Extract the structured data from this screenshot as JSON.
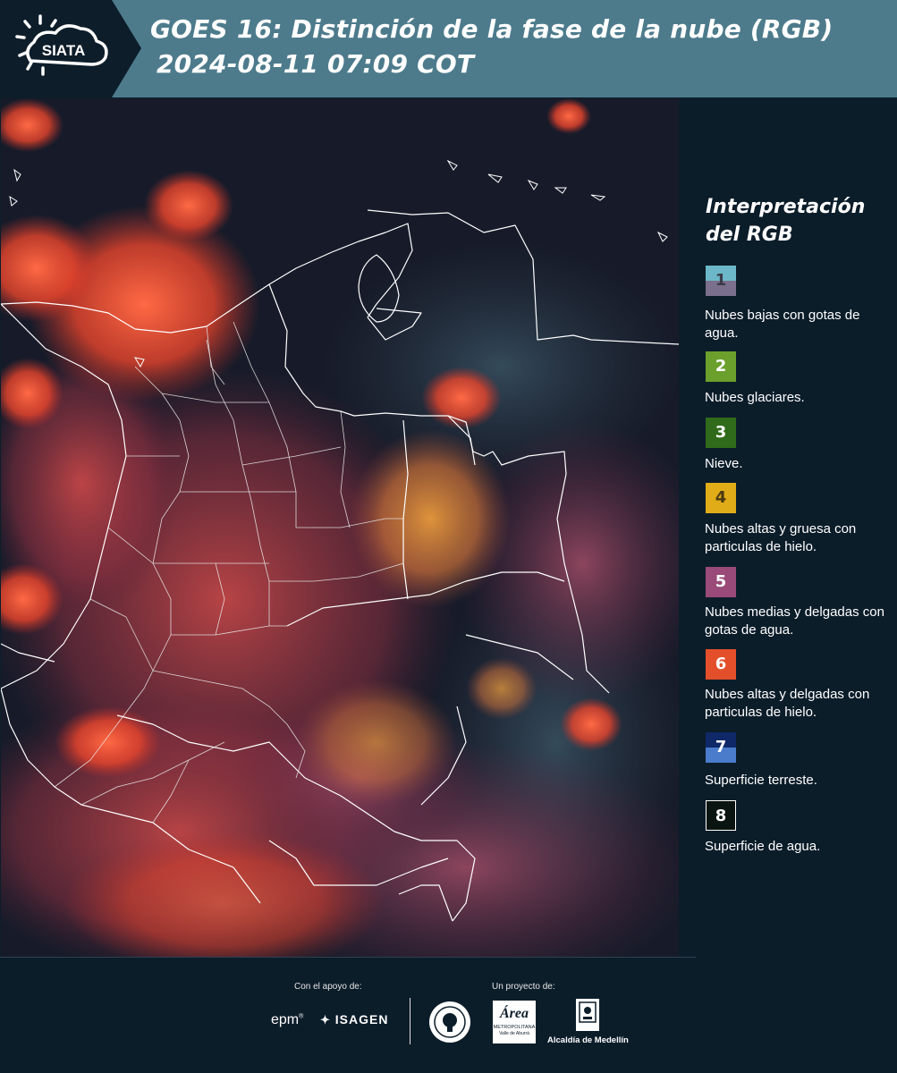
{
  "header": {
    "logo_text": "SIATA",
    "title_line1": "GOES 16: Distinción de la fase de la nube (RGB)",
    "title_line2": "2024-08-11 07:09 COT"
  },
  "map": {
    "description_icon": "satellite-rgb-image"
  },
  "legend": {
    "title": "Interpretación del RGB",
    "items": [
      {
        "number": "1",
        "label": "Nubes bajas con gotas de agua.",
        "color_top": "#6cb8c8",
        "color_bottom": "#7a6f8c"
      },
      {
        "number": "2",
        "label": "Nubes glaciares.",
        "color": "#6ba02c"
      },
      {
        "number": "3",
        "label": "Nieve.",
        "color": "#2f6b1a"
      },
      {
        "number": "4",
        "label": "Nubes altas y gruesa con particulas de hielo.",
        "color": "#e0ac18"
      },
      {
        "number": "5",
        "label": "Nubes medias y delgadas con gotas de agua.",
        "color": "#9a4a78"
      },
      {
        "number": "6",
        "label": "Nubes altas y delgadas con particulas de hielo.",
        "color": "#e34f2a"
      },
      {
        "number": "7",
        "label": "Superficie terreste.",
        "color_top": "#0e2868",
        "color_bottom": "#4b7ccc"
      },
      {
        "number": "8",
        "label": "Superficie de agua.",
        "color": "#0a1410"
      }
    ]
  },
  "footer": {
    "support_caption": "Con el apoyo de:",
    "project_caption": "Un proyecto de:",
    "sponsor_epm": "epm",
    "sponsor_isagen": "ISAGEN",
    "area_text": "Área",
    "area_sub1": "METROPOLITANA",
    "area_sub2": "Valle de Aburrá",
    "alcaldia": "Alcaldía de Medellín"
  }
}
